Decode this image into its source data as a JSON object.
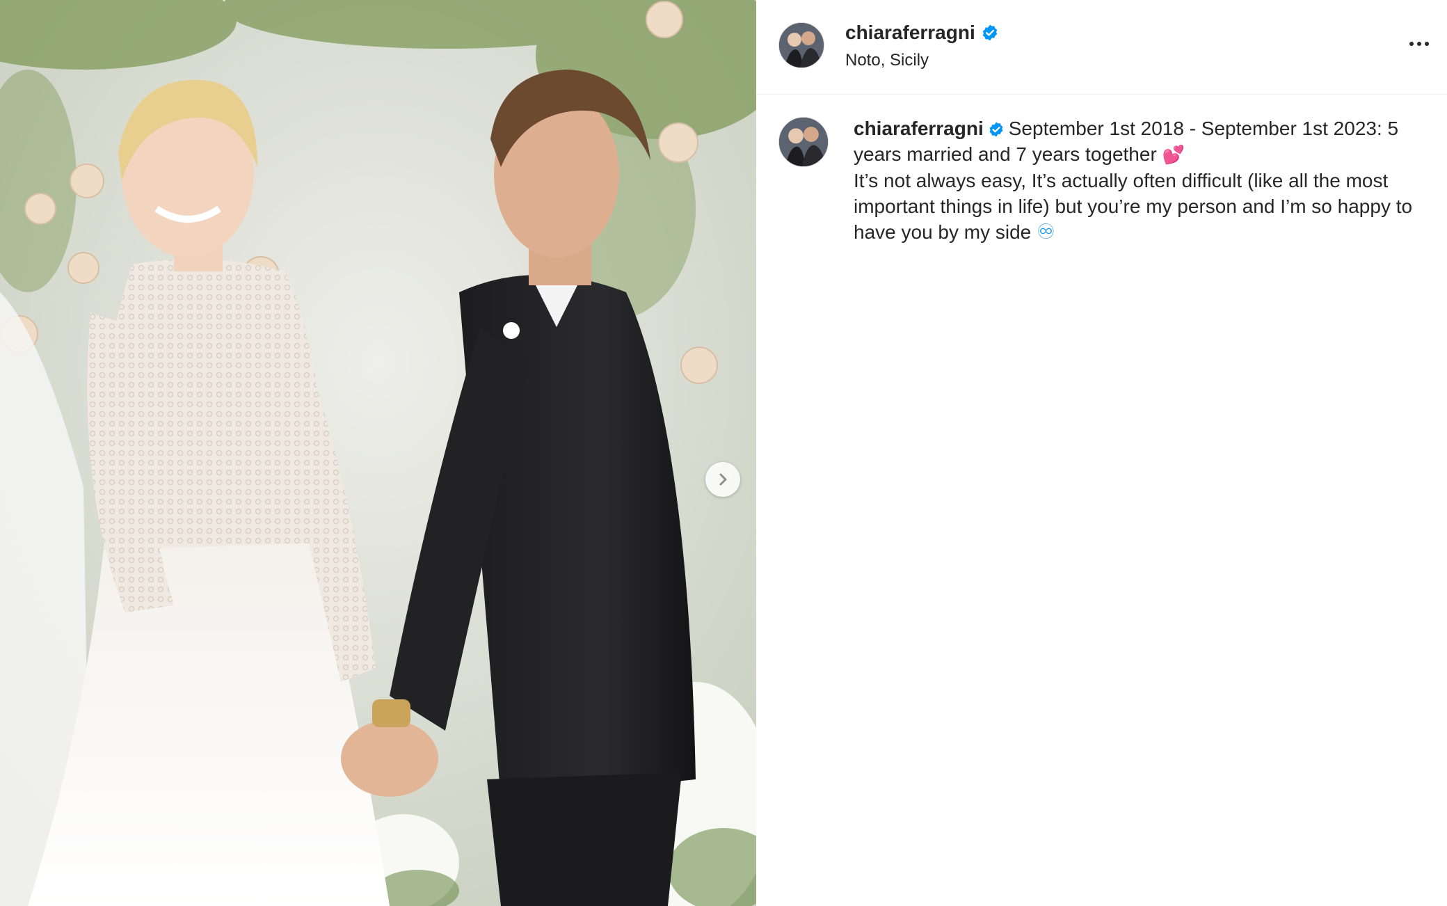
{
  "post": {
    "username": "chiaraferragni",
    "verified": true,
    "location": "Noto, Sicily",
    "caption": {
      "username": "chiaraferragni",
      "line1": "September 1st 2018 - September 1st 2023: 5 years married and 7 years together",
      "line1_emoji": "💕",
      "line2": "It’s not always easy, It’s actually often difficult (like all the most important things in life) but you’re my person and I’m so happy to have you by my side",
      "line2_emoji": "♾"
    }
  },
  "icons": {
    "verified_badge": "verified-badge-icon",
    "more_options": "more-options-icon",
    "next_slide": "chevron-right-icon"
  },
  "colors": {
    "verified": "#0095f6",
    "text": "#262626",
    "divider": "#efefef"
  }
}
